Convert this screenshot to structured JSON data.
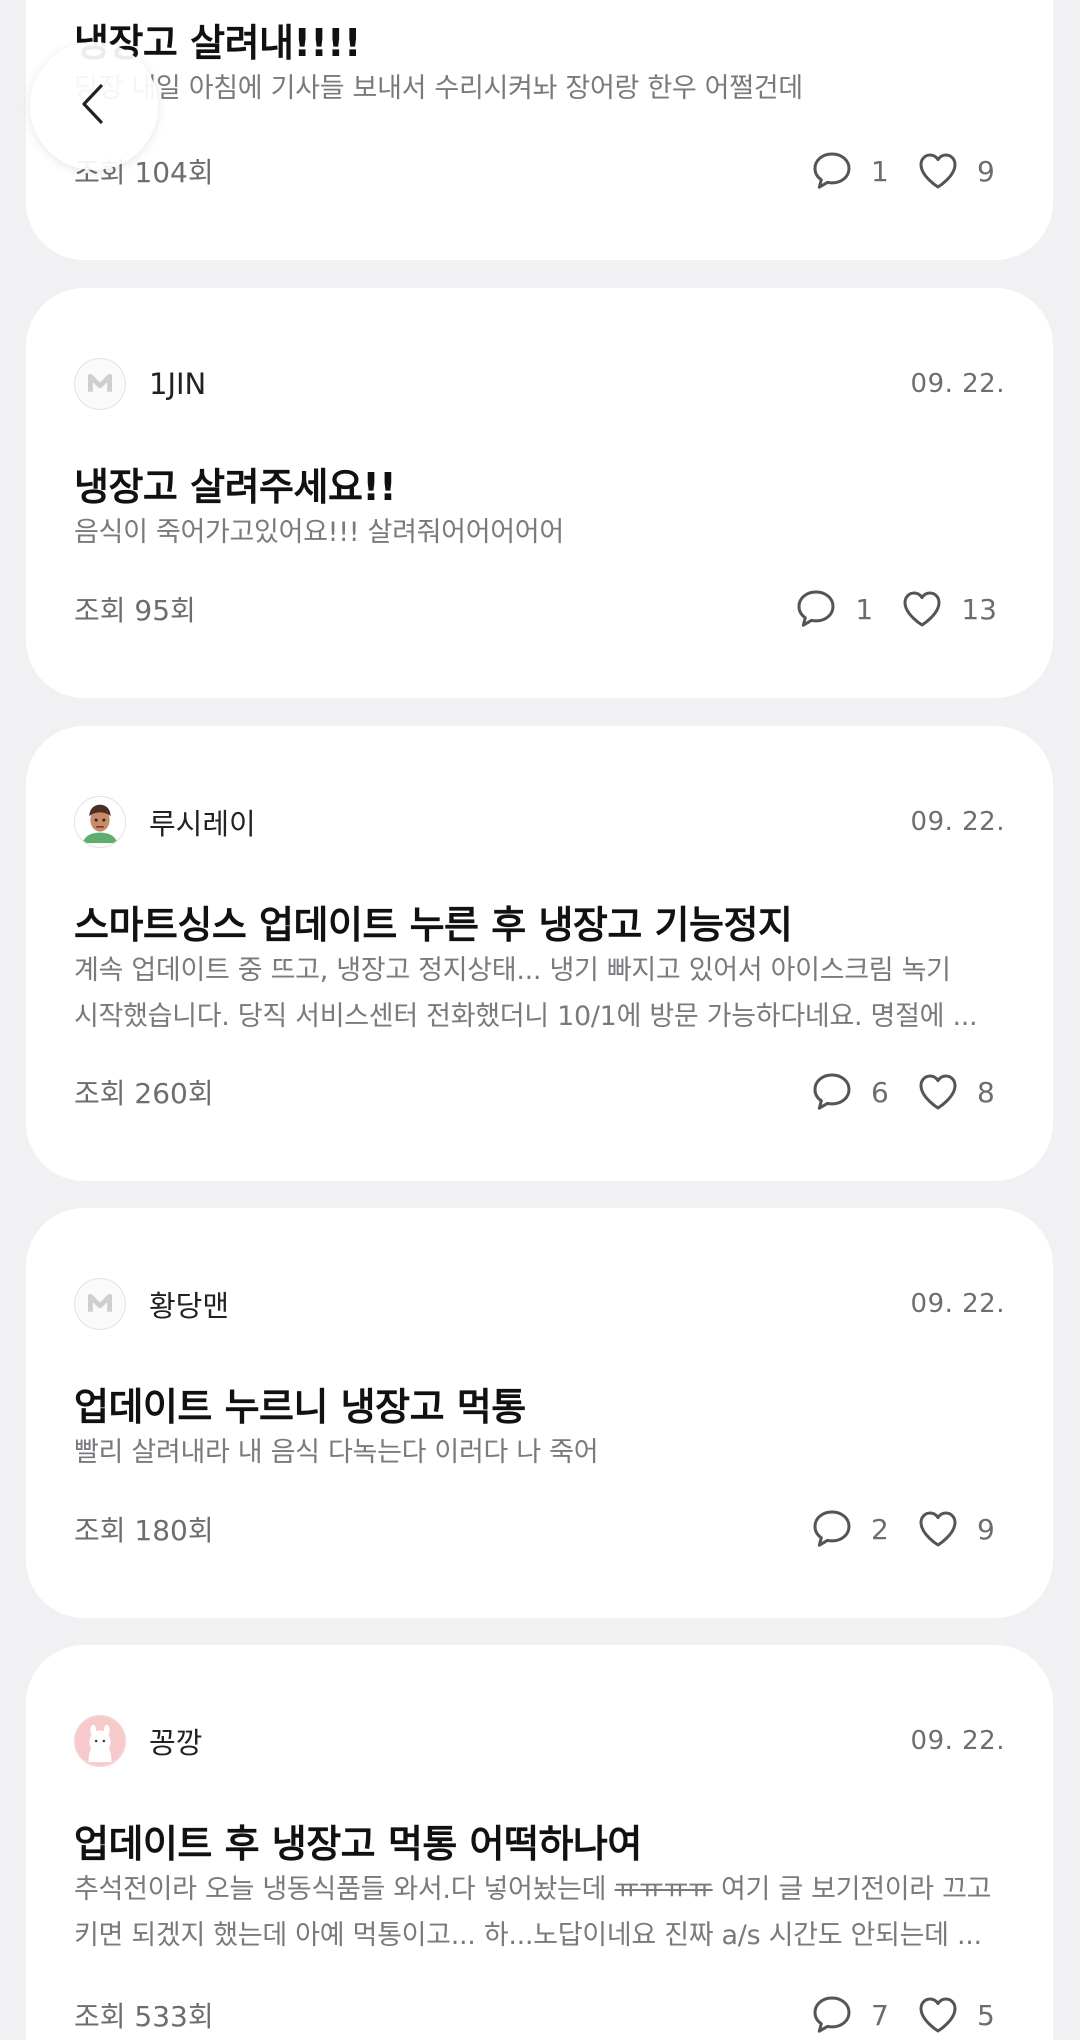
{
  "nav": {
    "back_icon": "chevron-left-icon"
  },
  "posts": [
    {
      "author": "",
      "date": "",
      "title": "냉장고 살려내!!!!",
      "excerpt": [
        "당장 내일 아침에 기사들 보내서 수리시켜놔  장어랑 한우 어쩔건데"
      ],
      "views": "조회 104회",
      "comments": "1",
      "likes": "9"
    },
    {
      "author": "1JIN",
      "avatar_icon": "m-logo-icon",
      "date": "09. 22.",
      "title": "냉장고 살려주세요!!",
      "excerpt": [
        "음식이 죽어가고있어요!!!   살려줘어어어어어"
      ],
      "views": "조회 95회",
      "comments": "1",
      "likes": "13"
    },
    {
      "author": "루시레이",
      "avatar_icon": "character-avatar-icon",
      "date": "09. 22.",
      "title": "스마트싱스 업데이트 누른 후 냉장고 기능정지",
      "excerpt": [
        "계속 업데이트 중 뜨고,  냉장고 정지상태...  냉기 빠지고 있어서 아이스크림 녹기",
        "시작했습니다.  당직 서비스센터 전화했더니 10/1에 방문 가능하다네요.  명절에 ..."
      ],
      "views": "조회 260회",
      "comments": "6",
      "likes": "8"
    },
    {
      "author": "황당맨",
      "avatar_icon": "m-logo-icon",
      "date": "09. 22.",
      "title": "업데이트 누르니 냉장고 먹통",
      "excerpt": [
        "빨리 살려내라 내 음식 다녹는다  이러다 나 죽어"
      ],
      "views": "조회 180회",
      "comments": "2",
      "likes": "9"
    },
    {
      "author": "꽁깡",
      "avatar_icon": "moomin-avatar-icon",
      "date": "09. 22.",
      "title": "업데이트 후 냉장고 먹통 어떡하나여",
      "excerpt_a": "추석전이라 오늘 냉동식품들 와서.다 넣어놨는데 ",
      "excerpt_strike": "ㅠㅠㅠㅠ",
      "excerpt_b": "  여기 글 보기전이라 끄고",
      "excerpt_line2": "키면 되겠지 했는데 아예 먹통이고...  하...노답이네요 진짜 a/s 시간도 안되는데  ...",
      "views": "조회 533회",
      "comments": "7",
      "likes": "5"
    }
  ],
  "colors": {
    "background": "#f1f1f4",
    "card": "#ffffff",
    "title": "#111111",
    "muted": "#7a7a7e"
  }
}
